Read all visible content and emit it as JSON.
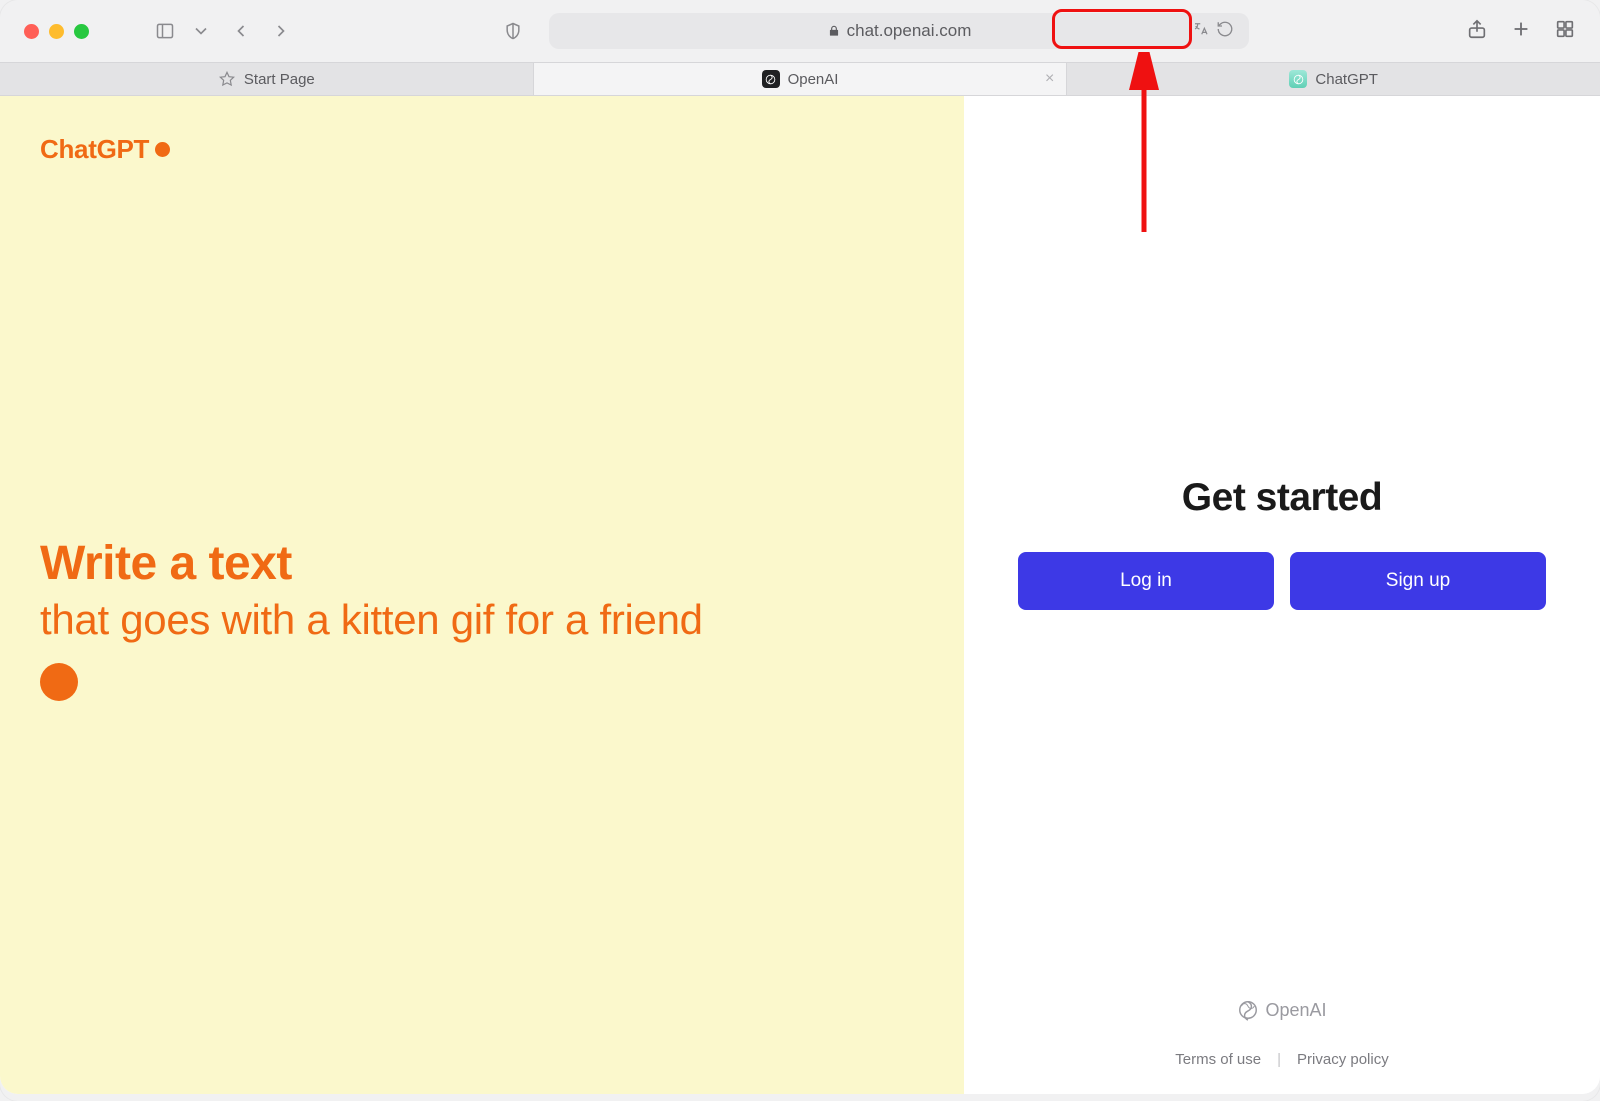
{
  "browser": {
    "url": "chat.openai.com"
  },
  "tabs": [
    {
      "label": "Start Page"
    },
    {
      "label": "OpenAI"
    },
    {
      "label": "ChatGPT"
    }
  ],
  "logo": {
    "text": "ChatGPT"
  },
  "prompt": {
    "heading": "Write a text",
    "sub": "that goes with a kitten gif for a friend"
  },
  "auth": {
    "heading": "Get started",
    "login_label": "Log in",
    "signup_label": "Sign up"
  },
  "footer": {
    "brand": "OpenAI",
    "terms": "Terms of use",
    "privacy": "Privacy policy"
  }
}
